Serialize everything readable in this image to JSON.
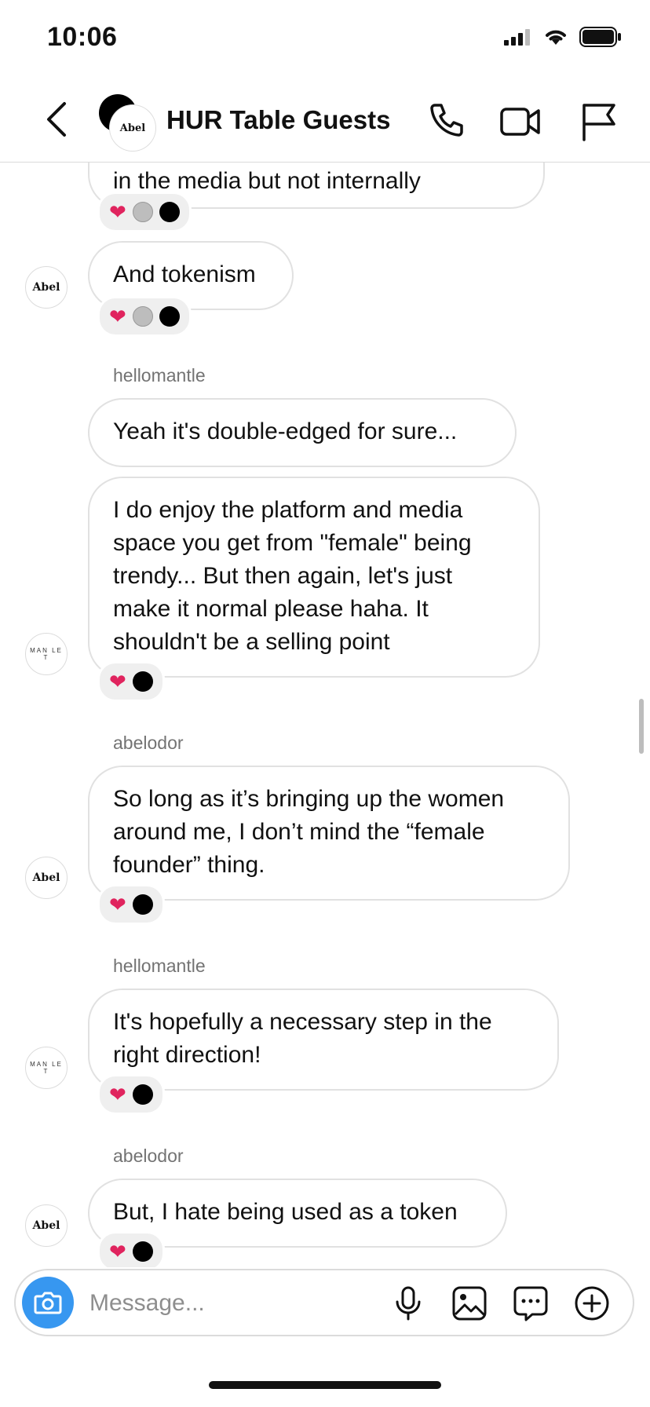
{
  "status_bar": {
    "time": "10:06"
  },
  "header": {
    "title": "HUR Table Guests",
    "avatar_label": "Abel"
  },
  "messages": [
    {
      "text": "in the media but not internally"
    },
    {
      "text": "And tokenism",
      "avatar": "Abel"
    },
    {
      "sender": "hellomantle"
    },
    {
      "text": "Yeah it's double-edged for sure..."
    },
    {
      "text": "I do enjoy the platform and media space you get from \"female\" being trendy... But then again, let's just make it normal please haha. It shouldn't be a selling point",
      "avatar": "MANTLE"
    },
    {
      "sender": "abelodor"
    },
    {
      "text": "So long as it’s bringing up the women around me, I don’t mind the “female founder” thing.",
      "avatar": "Abel"
    },
    {
      "sender": "hellomantle"
    },
    {
      "text": "It's hopefully a necessary step in the right direction!",
      "avatar": "MANTLE"
    },
    {
      "sender": "abelodor"
    },
    {
      "text": "But, I hate being used as a token",
      "avatar": "Abel"
    }
  ],
  "avatars": {
    "abel": "Abel",
    "mantle_top": "MAN LE",
    "mantle_bottom": "T"
  },
  "reaction_emoji": "❤",
  "composer": {
    "placeholder": "Message..."
  },
  "colors": {
    "accent": "#3797f0",
    "heart": "#e0245e"
  }
}
